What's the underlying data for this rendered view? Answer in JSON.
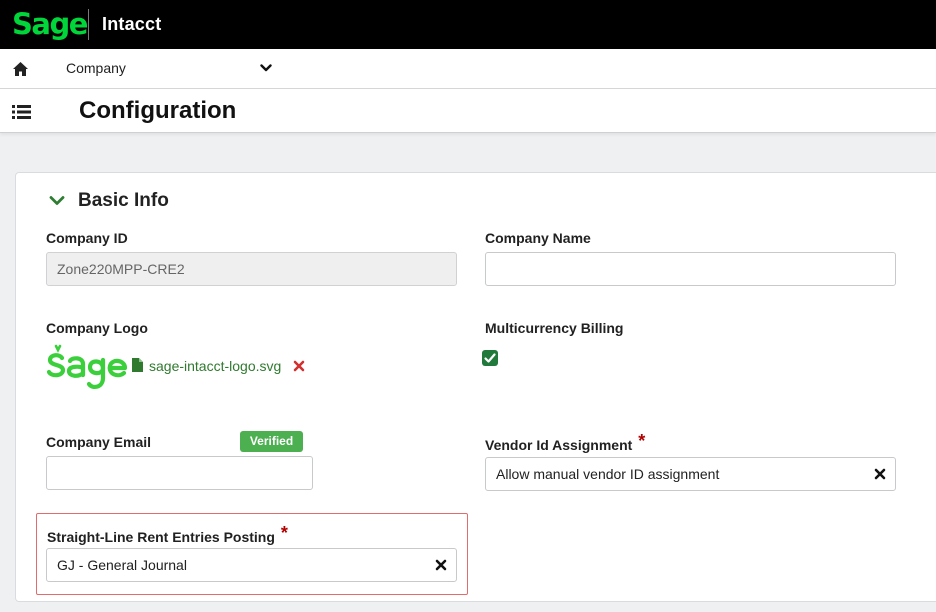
{
  "topbar": {
    "brand": "Sage",
    "product": "Intacct"
  },
  "company_bar": {
    "selected": "Company"
  },
  "page": {
    "title": "Configuration"
  },
  "section": {
    "title": "Basic Info"
  },
  "fields": {
    "company_id": {
      "label": "Company ID",
      "value": "Zone220MPP-CRE2"
    },
    "company_name": {
      "label": "Company Name",
      "value": ""
    },
    "company_logo": {
      "label": "Company Logo",
      "file_name": "sage-intacct-logo.svg"
    },
    "multicurrency": {
      "label": "Multicurrency Billing",
      "checked": true
    },
    "company_email": {
      "label": "Company Email",
      "badge": "Verified",
      "value": ""
    },
    "vendor_id": {
      "label": "Vendor Id Assignment",
      "required_mark": "*",
      "value": "Allow manual vendor ID assignment"
    },
    "straight_line": {
      "label": "Straight-Line Rent Entries Posting",
      "required_mark": "*",
      "value": "GJ - General Journal"
    }
  },
  "colors": {
    "brand_green": "#00d639",
    "topbar_bg": "#000000",
    "checkbox_green": "#217a3c",
    "badge_green": "#4caf50",
    "required_red": "#b00000",
    "highlight_border": "#e06c6c"
  },
  "icons": [
    "home-icon",
    "chevron-down-icon",
    "menu-icon",
    "file-icon",
    "remove-icon",
    "checkmark-icon",
    "clear-icon"
  ]
}
